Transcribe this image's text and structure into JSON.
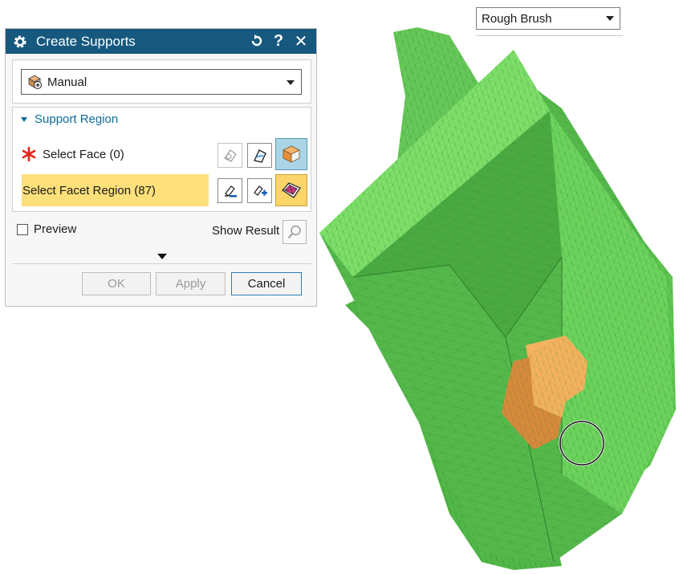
{
  "viewport": {
    "brush_value": "Rough Brush"
  },
  "dialog": {
    "title": "Create Supports",
    "title_icons": [
      "gear-icon",
      "reset-icon",
      "help-icon",
      "close-icon"
    ],
    "help_glyph": "?",
    "close_glyph": "✕",
    "type_value": "Manual",
    "support_region": {
      "header": "Support Region",
      "select_face_label": "Select Face (0)",
      "select_facet_label": "Select Facet Region (87)"
    },
    "preview_label": "Preview",
    "preview_checked": false,
    "show_result_label": "Show Result",
    "buttons": {
      "ok": "OK",
      "apply": "Apply",
      "cancel": "Cancel"
    }
  },
  "colors": {
    "title_bar": "#16587e",
    "section_header": "#0e6a98",
    "facet_highlight": "#fde07a",
    "model_green": "#5bc34e",
    "selection_orange": "#f2a552"
  }
}
